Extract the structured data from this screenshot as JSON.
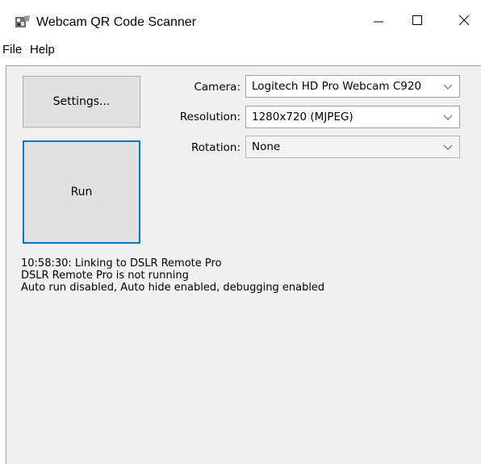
{
  "window": {
    "title": "Webcam QR Code Scanner",
    "icon": "camera-app-icon",
    "controls": [
      "minimize-icon",
      "maximize-icon",
      "close-icon"
    ]
  },
  "menu": {
    "items": [
      {
        "label": "File"
      },
      {
        "label": "Help"
      }
    ]
  },
  "buttons": {
    "settings_label": "Settings...",
    "run_label": "Run"
  },
  "fields": {
    "camera": {
      "label": "Camera:",
      "value": "Logitech HD Pro Webcam C920"
    },
    "resolution": {
      "label": "Resolution:",
      "value": "1280x720 (MJPEG)"
    },
    "rotation": {
      "label": "Rotation:",
      "value": "None"
    }
  },
  "log": {
    "lines": [
      "10:58:30: Linking to DSLR Remote Pro",
      "DSLR Remote Pro is not running",
      "Auto run disabled, Auto hide enabled, debugging enabled"
    ]
  },
  "colors": {
    "client_background": "#f0f0f0",
    "button_face": "#e1e1e1",
    "focus_border": "#0078d7"
  }
}
